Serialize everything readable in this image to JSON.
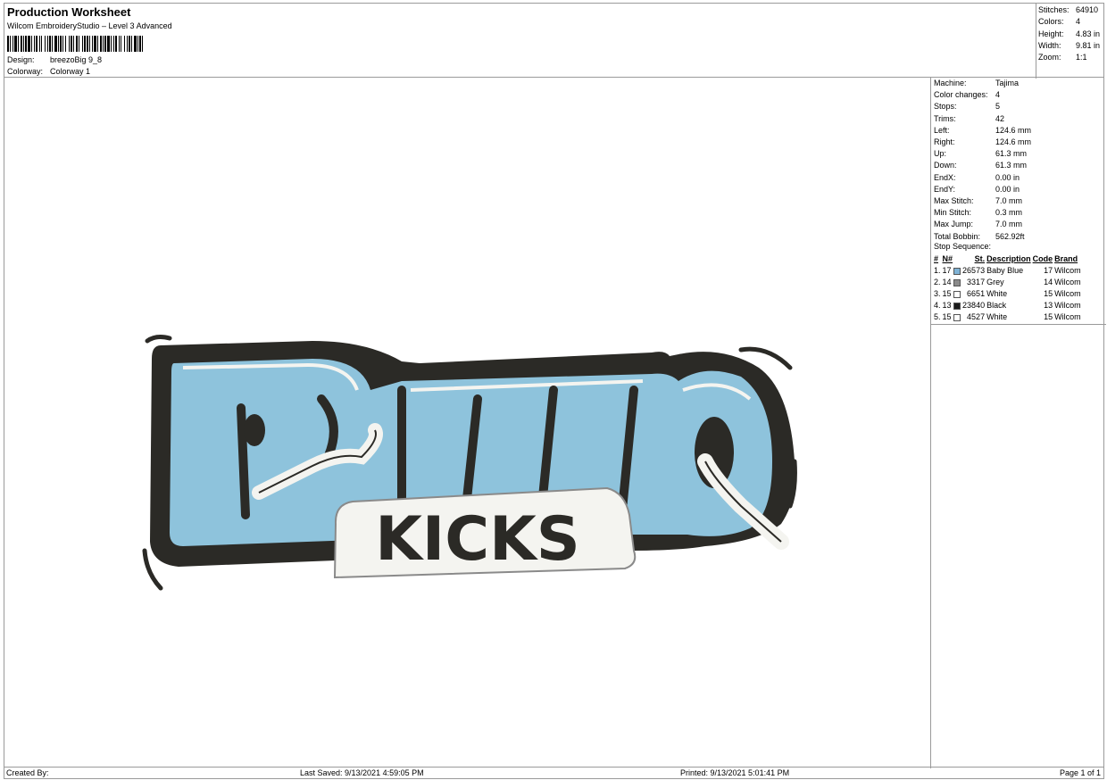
{
  "header": {
    "title": "Production Worksheet",
    "subtitle": "Wilcom EmbroideryStudio – Level 3 Advanced",
    "design_label": "Design:",
    "design_value": "breezoBig 9_8",
    "colorway_label": "Colorway:",
    "colorway_value": "Colorway 1",
    "stats": [
      {
        "label": "Stitches:",
        "value": "64910"
      },
      {
        "label": "Colors:",
        "value": "4"
      },
      {
        "label": "Height:",
        "value": "4.83 in"
      },
      {
        "label": "Width:",
        "value": "9.81 in"
      },
      {
        "label": "Zoom:",
        "value": "1:1"
      }
    ]
  },
  "machine_info": [
    {
      "label": "Machine:",
      "value": "Tajima"
    },
    {
      "label": "Color changes:",
      "value": "4"
    },
    {
      "label": "Stops:",
      "value": "5"
    },
    {
      "label": "Trims:",
      "value": "42"
    },
    {
      "label": "Left:",
      "value": "124.6 mm"
    },
    {
      "label": "Right:",
      "value": "124.6 mm"
    },
    {
      "label": "Up:",
      "value": "61.3 mm"
    },
    {
      "label": "Down:",
      "value": "61.3 mm"
    },
    {
      "label": "EndX:",
      "value": "0.00 in"
    },
    {
      "label": "EndY:",
      "value": "0.00 in"
    },
    {
      "label": "Max Stitch:",
      "value": "7.0 mm"
    },
    {
      "label": "Min Stitch:",
      "value": "0.3 mm"
    },
    {
      "label": "Max Jump:",
      "value": "7.0 mm"
    },
    {
      "label": "Total Bobbin:",
      "value": "562.92ft"
    }
  ],
  "stop_sequence": {
    "label": "Stop Sequence:",
    "columns": [
      "#",
      "N#",
      "St.",
      "Description",
      "Code",
      "Brand"
    ],
    "rows": [
      {
        "num": "1.",
        "n": "17",
        "color": "#7fb3d6",
        "st": "26573",
        "desc": "Baby Blue",
        "code": "17",
        "brand": "Wilcom"
      },
      {
        "num": "2.",
        "n": "14",
        "color": "#8a8a8a",
        "st": "3317",
        "desc": "Grey",
        "code": "14",
        "brand": "Wilcom"
      },
      {
        "num": "3.",
        "n": "15",
        "color": "#ffffff",
        "st": "6651",
        "desc": "White",
        "code": "15",
        "brand": "Wilcom"
      },
      {
        "num": "4.",
        "n": "13",
        "color": "#1a1a1a",
        "st": "23840",
        "desc": "Black",
        "code": "13",
        "brand": "Wilcom"
      },
      {
        "num": "5.",
        "n": "15",
        "color": "#ffffff",
        "st": "4527",
        "desc": "White",
        "code": "15",
        "brand": "Wilcom"
      }
    ]
  },
  "artwork": {
    "main_word": "BREZO",
    "sub_word": "KICKS",
    "colors": {
      "baby_blue": "#8ec3dc",
      "black": "#2b2a26",
      "grey": "#8a8a8a",
      "white": "#f4f4f0"
    }
  },
  "footer": {
    "created_by": "Created By:",
    "last_saved": "Last Saved: 9/13/2021 4:59:05 PM",
    "printed": "Printed: 9/13/2021 5:01:41 PM",
    "page": "Page 1 of 1"
  }
}
